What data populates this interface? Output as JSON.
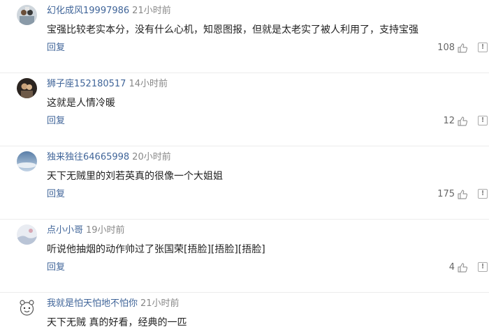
{
  "comments": [
    {
      "username": "幻化成风19997986",
      "time": "21小时前",
      "text": "宝强比较老实本分，没有什么心机，知恩图报，但就是太老实了被人利用了，支持宝强",
      "reply_label": "回复",
      "likes": "108",
      "avatar_icon": "user-avatar-group-photo"
    },
    {
      "username": "狮子座152180517",
      "time": "14小时前",
      "text": "这就是人情冷暖",
      "reply_label": "回复",
      "likes": "12",
      "avatar_icon": "user-avatar-couple-photo"
    },
    {
      "username": "独来独往64665998",
      "time": "20小时前",
      "text": "天下无贼里的刘若英真的很像一个大姐姐",
      "reply_label": "回复",
      "likes": "175",
      "avatar_icon": "user-avatar-sky"
    },
    {
      "username": "点小小哥",
      "time": "19小时前",
      "text": "听说他抽烟的动作帅过了张国荣[捂脸][捂脸][捂脸]",
      "reply_label": "回复",
      "likes": "4",
      "avatar_icon": "user-avatar-landscape"
    },
    {
      "username": "我就是怕天怕地不怕你",
      "time": "21小时前",
      "text": "天下无贼 真的好看，经典的一匹",
      "avatar_icon": "user-avatar-cartoon"
    }
  ],
  "colors": {
    "username": "#406599",
    "time": "#888888",
    "text": "#222222",
    "divider": "#ececec"
  },
  "icons": {
    "like": "thumbs-up-icon",
    "report": "report-icon"
  }
}
